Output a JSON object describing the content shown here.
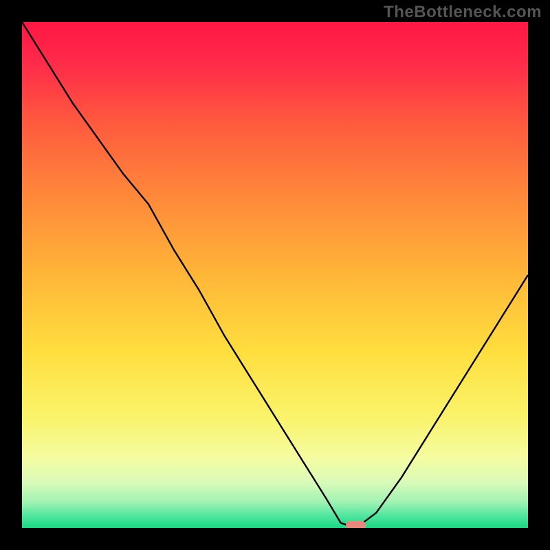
{
  "watermark": "TheBottleneck.com",
  "chart_data": {
    "type": "line",
    "title": "",
    "xlabel": "",
    "ylabel": "",
    "xlim": [
      0,
      100
    ],
    "ylim": [
      0,
      100
    ],
    "grid": false,
    "legend": false,
    "series": [
      {
        "name": "bottleneck-curve",
        "x": [
          0,
          5,
          10,
          15,
          20,
          25,
          30,
          35,
          40,
          45,
          50,
          55,
          60,
          63,
          66,
          70,
          75,
          80,
          85,
          90,
          95,
          100
        ],
        "y": [
          100,
          92,
          84,
          77,
          70,
          64,
          55,
          47,
          38,
          30,
          22,
          14,
          6,
          1,
          0,
          3,
          10,
          18,
          26,
          34,
          42,
          50
        ]
      }
    ],
    "marker": {
      "x": 66,
      "y": 0,
      "color": "#e9877d",
      "width": 4,
      "height": 2
    },
    "background_gradient": {
      "stops": [
        {
          "offset": 0.0,
          "color": "#ff1744"
        },
        {
          "offset": 0.08,
          "color": "#ff2a4a"
        },
        {
          "offset": 0.2,
          "color": "#ff5a3e"
        },
        {
          "offset": 0.35,
          "color": "#ff8a3a"
        },
        {
          "offset": 0.5,
          "color": "#ffb638"
        },
        {
          "offset": 0.65,
          "color": "#ffde3e"
        },
        {
          "offset": 0.78,
          "color": "#faf36a"
        },
        {
          "offset": 0.86,
          "color": "#f5fca0"
        },
        {
          "offset": 0.91,
          "color": "#d9fbb9"
        },
        {
          "offset": 0.95,
          "color": "#9ef2b2"
        },
        {
          "offset": 0.975,
          "color": "#53e6a0"
        },
        {
          "offset": 1.0,
          "color": "#17d884"
        }
      ]
    }
  }
}
